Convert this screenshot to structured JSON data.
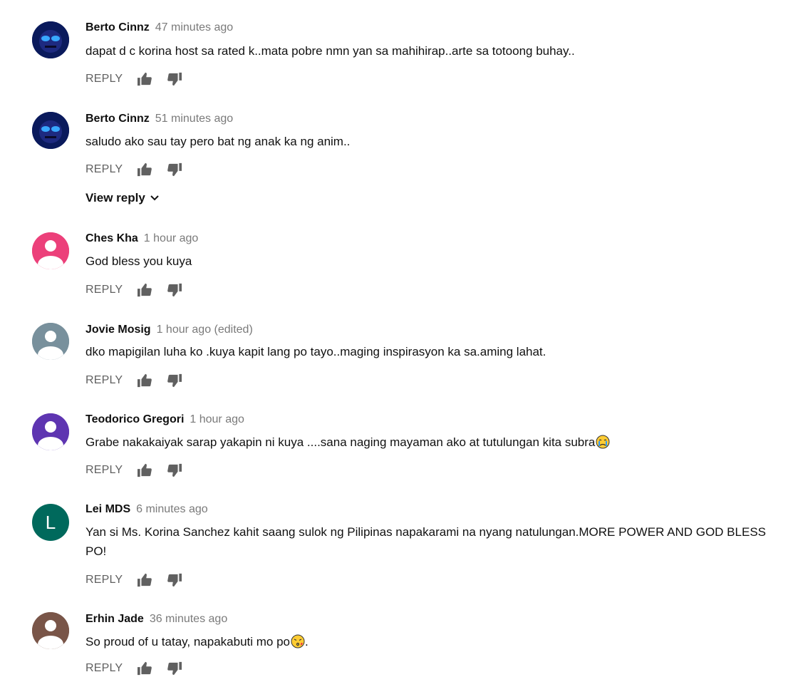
{
  "reply_label": "REPLY",
  "view_reply_label": "View reply",
  "comments": [
    {
      "author": "Berto Cinnz",
      "time": "47 minutes ago",
      "text": "dapat d c korina host sa rated k..mata pobre nmn yan sa mahihirap..arte sa totoong buhay..",
      "avatar": "photo",
      "avatar_color": "#0a1a5c"
    },
    {
      "author": "Berto Cinnz",
      "time": "51 minutes ago",
      "text": "saludo ako sau tay pero bat ng anak ka ng anim..",
      "avatar": "photo",
      "avatar_color": "#0a1a5c"
    },
    {
      "author": "Ches Kha",
      "time": "1 hour ago",
      "text": "God bless you kuya",
      "avatar": "default",
      "avatar_color": "#ec407a"
    },
    {
      "author": "Jovie Mosig",
      "time": "1 hour ago (edited)",
      "text": "dko mapigilan luha ko .kuya kapit lang po tayo..maging inspirasyon ka sa.aming lahat.",
      "avatar": "default",
      "avatar_color": "#78909c"
    },
    {
      "author": "Teodorico Gregori",
      "time": "1 hour ago",
      "text": "Grabe nakakaiyak sarap yakapin ni kuya ....sana naging mayaman ako at tutulungan kita subra",
      "avatar": "default",
      "avatar_color": "#5e35b1",
      "emoji": "crying-face-emoji"
    },
    {
      "author": "Lei MDS",
      "time": "6 minutes ago",
      "text": "Yan si Ms. Korina Sanchez kahit saang sulok ng Pilipinas napakarami na nyang natulungan.MORE POWER AND GOD BLESS PO!",
      "avatar": "letter",
      "avatar_letter": "L",
      "avatar_color": "#00695c"
    },
    {
      "author": "Erhin Jade",
      "time": "36 minutes ago",
      "text": "So proud of u tatay, napakabuti mo po",
      "text_suffix": ".",
      "avatar": "default",
      "avatar_color": "#795548",
      "emoji": "kissing-face-emoji"
    }
  ]
}
